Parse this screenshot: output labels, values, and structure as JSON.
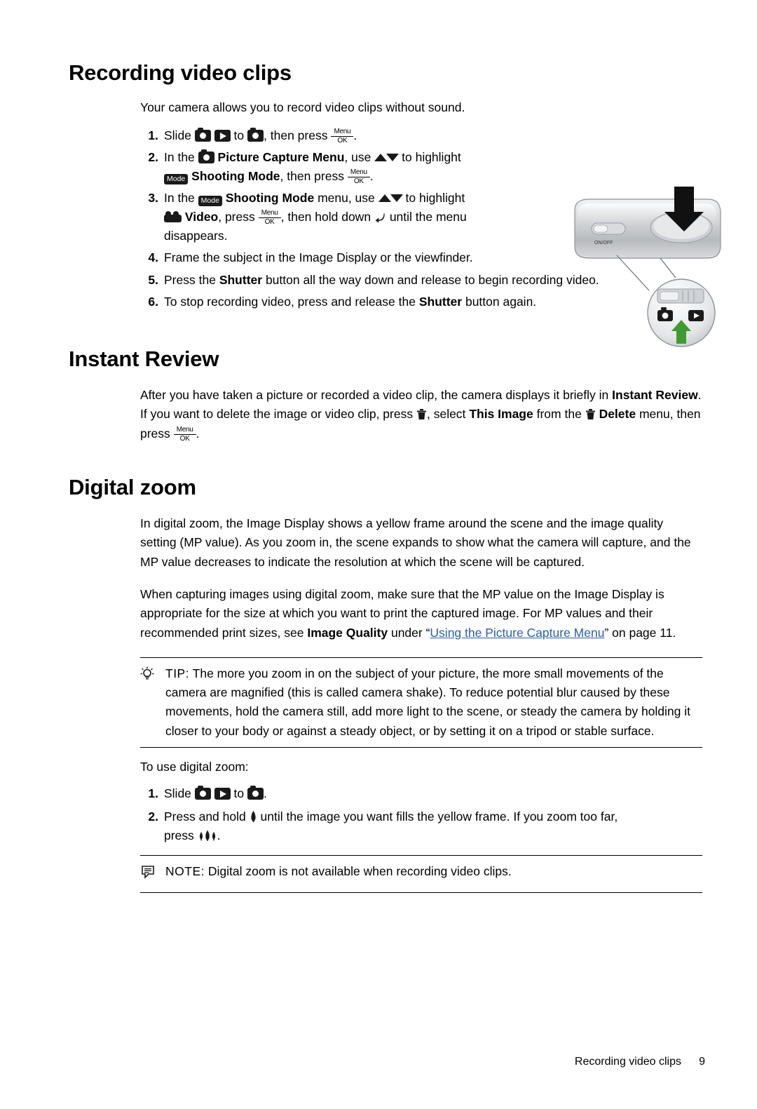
{
  "document": {
    "sections": [
      {
        "id": "recording-video-clips",
        "title": "Recording video clips",
        "intro": "Your camera allows you to record video clips without sound.",
        "steps": [
          {
            "num": "1."
          },
          {
            "num": "2."
          },
          {
            "num": "3."
          },
          {
            "num": "4.",
            "text": "Frame the subject in the Image Display or the viewfinder."
          },
          {
            "num": "5."
          },
          {
            "num": "6."
          }
        ]
      },
      {
        "id": "instant-review",
        "title": "Instant Review"
      },
      {
        "id": "digital-zoom",
        "title": "Digital zoom"
      }
    ]
  },
  "recording": {
    "step1": {
      "slide": "Slide",
      "to": "to",
      "then_press": ", then press",
      "period": "."
    },
    "step2": {
      "in_the": "In the",
      "picture_capture_menu": "Picture Capture Menu",
      "use": ", use",
      "to_highlight": "to highlight",
      "shooting_mode": "Shooting Mode",
      "then_press": ", then press",
      "period": "."
    },
    "step3": {
      "in_the": "In the",
      "shooting_mode": "Shooting Mode",
      "menu_use": "menu, use",
      "to_highlight": "to highlight",
      "video": "Video",
      "press": ", press",
      "then_hold_down": ", then hold down",
      "until_menu": "until the menu",
      "disappears": "disappears."
    },
    "step4": "Frame the subject in the Image Display or the viewfinder.",
    "step5": {
      "press_the": "Press the",
      "shutter": "Shutter",
      "rest": "button all the way down and release to begin recording video."
    },
    "step6": {
      "lead": "To stop recording video, press and release the",
      "shutter": "Shutter",
      "rest": "button again."
    }
  },
  "instant_review": {
    "para": {
      "p1": "After you have taken a picture or recorded a video clip, the camera displays it briefly in",
      "b1": "Instant Review",
      "p2": ". If you want to delete the image or video clip, press",
      "p3": ", select",
      "b2": "This Image",
      "p4": "from the",
      "b3": "Delete",
      "p5": "menu, then press",
      "p6": "."
    }
  },
  "digital_zoom": {
    "para1": "In digital zoom, the Image Display shows a yellow frame around the scene and the image quality setting (MP value). As you zoom in, the scene expands to show what the camera will capture, and the MP value decreases to indicate the resolution at which the scene will be captured.",
    "para2": {
      "p1": "When capturing images using digital zoom, make sure that the MP value on the Image Display is appropriate for the size at which you want to print the captured image. For MP values and their recommended print sizes, see",
      "b1": "Image Quality",
      "p2": "under “",
      "link": "Using the Picture Capture Menu",
      "p3": "” on page 11."
    },
    "tip": {
      "label": "TIP:",
      "text": "The more you zoom in on the subject of your picture, the more small movements of the camera are magnified (this is called camera shake). To reduce potential blur caused by these movements, hold the camera still, add more light to the scene, or steady the camera by holding it closer to your body or against a steady object, or by setting it on a tripod or stable surface."
    },
    "to_use": "To use digital zoom:",
    "step1": {
      "num": "1.",
      "slide": "Slide",
      "to": "to",
      "period": "."
    },
    "step2": {
      "num": "2.",
      "p1": "Press and hold",
      "p2": "until the image you want fills the yellow frame. If you zoom too far,",
      "p3": "press",
      "p4": "."
    },
    "note": {
      "label": "NOTE:",
      "text": "Digital zoom is not available when recording video clips."
    }
  },
  "icons": {
    "camera": "camera-icon",
    "playback": "playback-icon",
    "menu_ok": {
      "menu": "Menu",
      "ok": "OK"
    },
    "mode": "Mode",
    "arrows": "up-down-arrows-icon",
    "video": "video-camera-icon",
    "back": "back-arrow-icon",
    "trash": "trash-icon",
    "telephoto": "telephoto-zoom-icon",
    "wideangle": "wide-angle-zoom-icon",
    "tip": "lightbulb-icon",
    "note": "note-icon"
  },
  "footer": {
    "section": "Recording video clips",
    "page": "9"
  }
}
